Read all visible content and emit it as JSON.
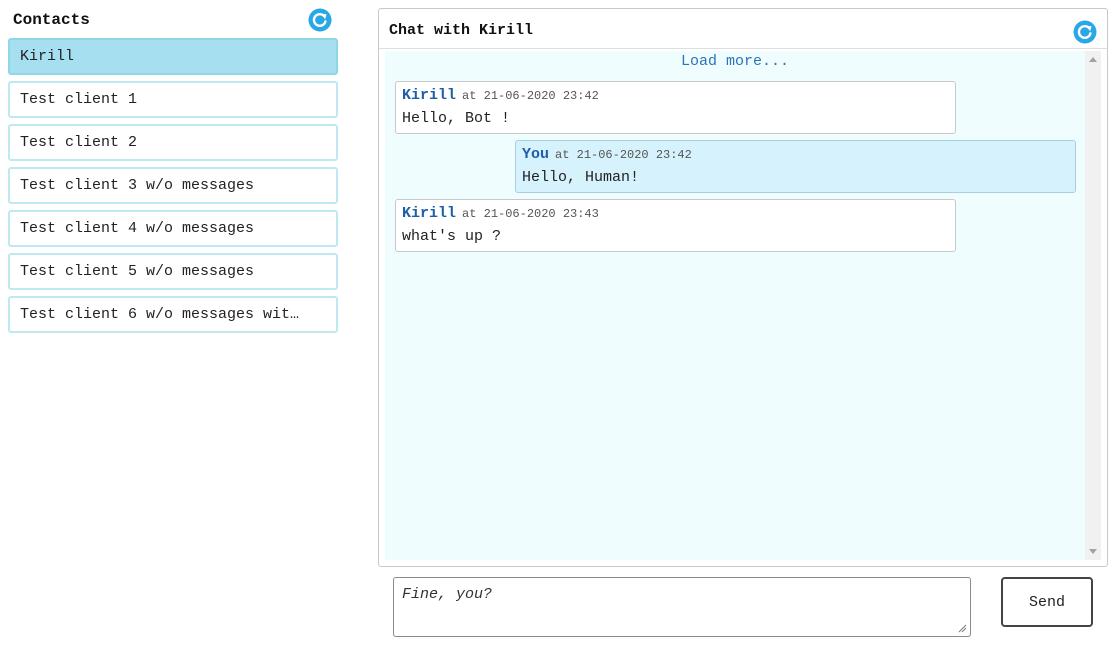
{
  "contacts": {
    "title": "Contacts",
    "refresh_icon": "refresh-icon",
    "items": [
      {
        "label": "Kirill",
        "active": true
      },
      {
        "label": "Test client 1"
      },
      {
        "label": "Test client 2"
      },
      {
        "label": "Test client 3 w/o messages"
      },
      {
        "label": "Test client 4 w/o messages"
      },
      {
        "label": "Test client 5 w/o messages"
      },
      {
        "label": "Test client 6 w/o messages wit…"
      }
    ]
  },
  "chat": {
    "title": "Chat with Kirill",
    "refresh_icon": "refresh-icon",
    "load_more": "Load more...",
    "messages": [
      {
        "author": "Kirill",
        "time": "at 21-06-2020 23:42",
        "text": "Hello, Bot !"
      },
      {
        "author": "You",
        "time": "at 21-06-2020 23:42",
        "text": "Hello, Human!"
      },
      {
        "author": "Kirill",
        "time": "at 21-06-2020 23:43",
        "text": "what's up ?"
      }
    ]
  },
  "composer": {
    "value": "Fine, you?",
    "send_label": "Send"
  },
  "colors": {
    "accent": "#2a74b8",
    "icon_blue": "#2aa7e6",
    "active_contact": "#a6dff0",
    "mine_message": "#d6f2fd",
    "chat_background": "#f0fdff"
  }
}
